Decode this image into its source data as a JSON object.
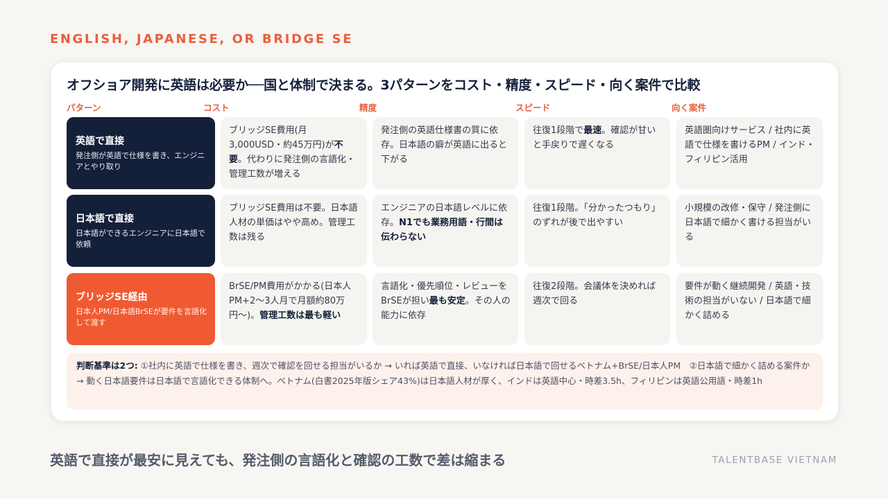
{
  "eyebrow": "ENGLISH, JAPANESE, OR BRIDGE SE",
  "title": "オフショア開発に英語は必要か──国と体制で決まる。3パターンをコスト・精度・スピード・向く案件で比較",
  "columns": [
    "パターン",
    "コスト",
    "精度",
    "スピード",
    "向く案件"
  ],
  "rows": [
    {
      "name": "英語で直接",
      "desc": "発注側が英語で仕様を書き、エンジニアとやり取り",
      "cost": {
        "a": "ブリッジSE費用(月3,000USD・約45万円)が",
        "b": "不要",
        "c": "。代わりに発注側の言語化・管理工数が増える"
      },
      "accuracy": {
        "a": "発注側の英語仕様書の質に依存。日本語の癖が英語に出ると下がる",
        "b": "",
        "c": ""
      },
      "speed": {
        "a": "往復1段階で",
        "b": "最速",
        "c": "。確認が甘いと手戻りで遅くなる"
      },
      "fit": "英語圏向けサービス / 社内に英語で仕様を書けるPM / インド・フィリピン活用"
    },
    {
      "name": "日本語で直接",
      "desc": "日本語ができるエンジニアに日本語で依頼",
      "cost": {
        "a": "ブリッジSE費用は不要。日本語人材の単価はやや高め。管理工数は残る",
        "b": "",
        "c": ""
      },
      "accuracy": {
        "a": "エンジニアの日本語レベルに依存。",
        "b": "N1でも業務用語・行間は伝わらない",
        "c": ""
      },
      "speed": {
        "a": "往復1段階。「分かったつもり」のずれが後で出やすい",
        "b": "",
        "c": ""
      },
      "fit": "小規模の改修・保守 / 発注側に日本語で細かく書ける担当がいる"
    },
    {
      "name": "ブリッジSE経由",
      "desc": "日本人PM/日本語BrSEが要件を言語化して渡す",
      "cost": {
        "a": "BrSE/PM費用がかかる(日本人PM+2〜3人月で月額約80万円〜)。",
        "b": "管理工数は最も軽い",
        "c": ""
      },
      "accuracy": {
        "a": "言語化・優先順位・レビューをBrSEが担い",
        "b": "最も安定",
        "c": "。その人の能力に依存"
      },
      "speed": {
        "a": "往復2段階。会議体を決めれば週次で回る",
        "b": "",
        "c": ""
      },
      "fit": "要件が動く継続開発 / 英語・技術の担当がいない / 日本語で細かく詰める"
    }
  ],
  "note": {
    "label": "判断基準は2つ:",
    "text": " ①社内に英語で仕様を書き、週次で確認を回せる担当がいるか → いれば英語で直接、いなければ日本語で回せるベトナム+BrSE/日本人PM　②日本語で細かく詰める案件か → 動く日本語要件は日本語で言語化できる体制へ。ベトナム(白書2025年版シェア43%)は日本語人材が厚く、インドは英語中心・時差3.5h、フィリピンは英語公用語・時差1h"
  },
  "footer": {
    "main": "英語で直接が最安に見えても、発注側の言語化と確認の工数で差は縮まる",
    "brand": "TALENTBASE VIETNAM"
  },
  "colors": {
    "accent": "#e8603c",
    "navy": "#14203a",
    "bridge": "#ef5a32"
  }
}
